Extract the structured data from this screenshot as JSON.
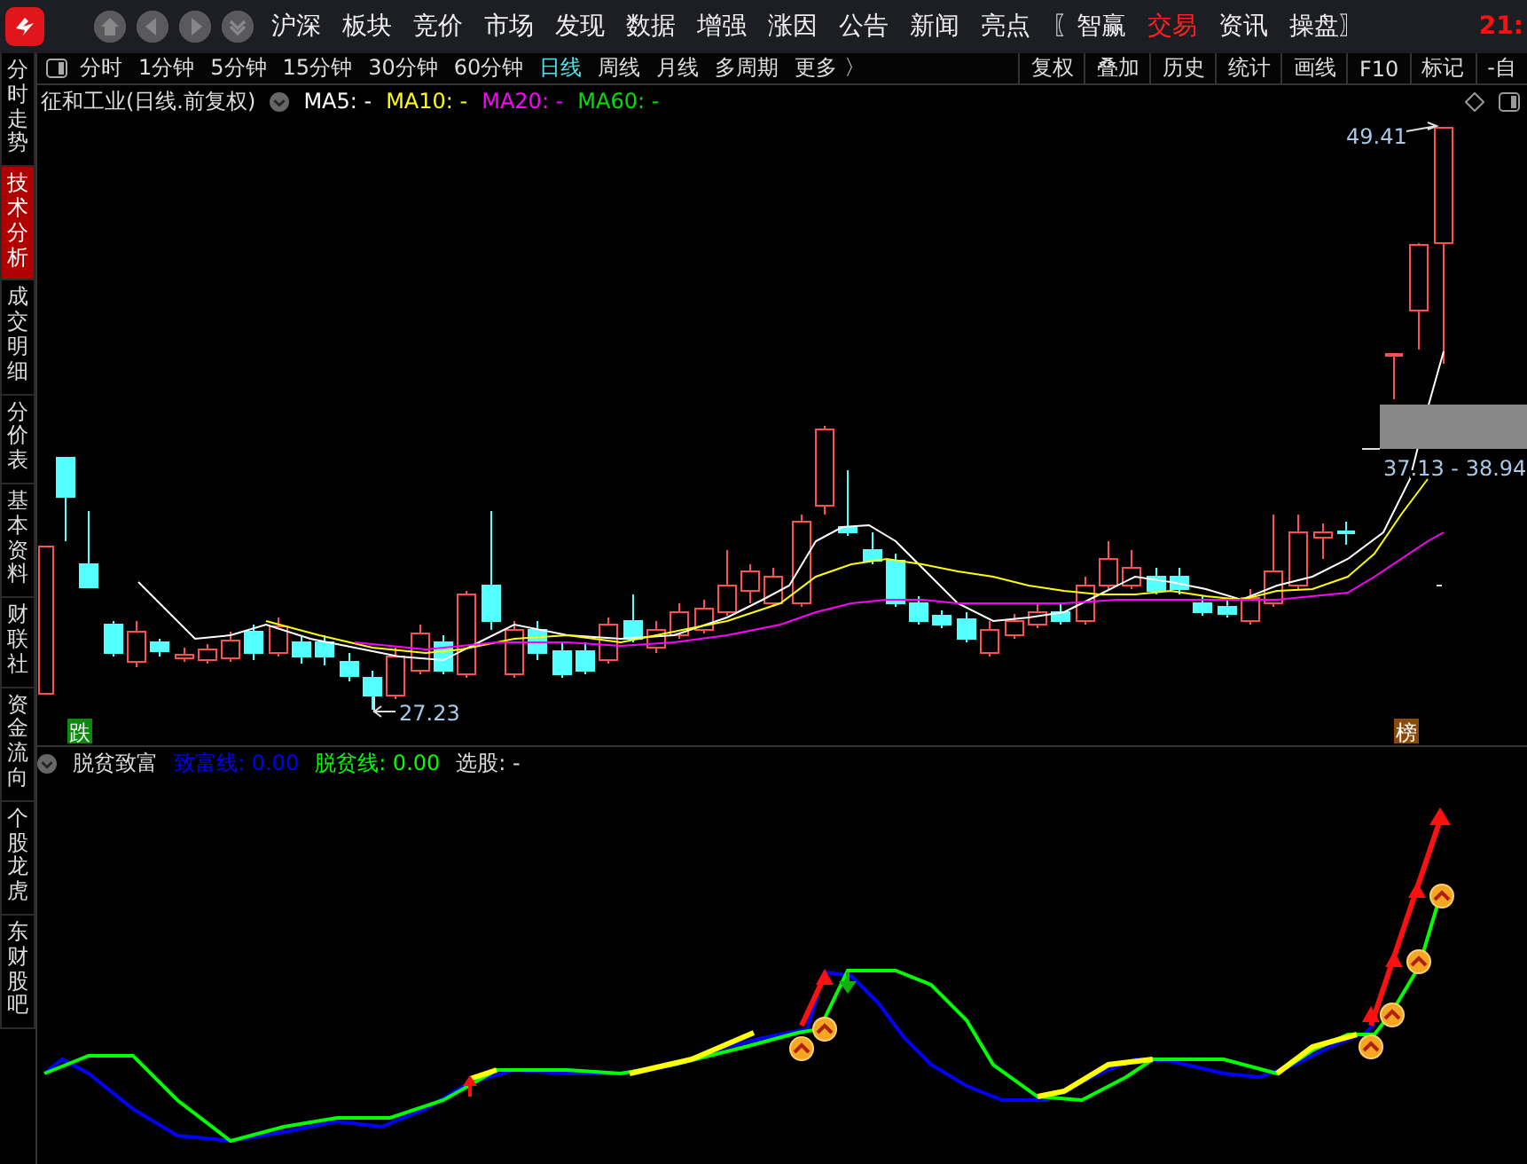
{
  "top_bar": {
    "menu": [
      {
        "label": "沪深",
        "selected": false
      },
      {
        "label": "板块",
        "selected": false
      },
      {
        "label": "竞价",
        "selected": false
      },
      {
        "label": "市场",
        "selected": false
      },
      {
        "label": "发现",
        "selected": false
      },
      {
        "label": "数据",
        "selected": false
      },
      {
        "label": "增强",
        "selected": false
      },
      {
        "label": "涨因",
        "selected": false
      },
      {
        "label": "公告",
        "selected": false
      },
      {
        "label": "新闻",
        "selected": false
      },
      {
        "label": "亮点",
        "selected": false
      },
      {
        "label": "〖智赢",
        "selected": false
      },
      {
        "label": "交易",
        "selected": true
      },
      {
        "label": "资讯",
        "selected": false
      },
      {
        "label": "操盘〗",
        "selected": false
      }
    ],
    "clock": "21:"
  },
  "period_tabs": [
    {
      "label": "分时",
      "selected": false
    },
    {
      "label": "1分钟",
      "selected": false
    },
    {
      "label": "5分钟",
      "selected": false
    },
    {
      "label": "15分钟",
      "selected": false
    },
    {
      "label": "30分钟",
      "selected": false
    },
    {
      "label": "60分钟",
      "selected": false
    },
    {
      "label": "日线",
      "selected": true
    },
    {
      "label": "周线",
      "selected": false
    },
    {
      "label": "月线",
      "selected": false
    },
    {
      "label": "多周期",
      "selected": false
    },
    {
      "label": "更多 〉",
      "selected": false
    }
  ],
  "tools": [
    "复权",
    "叠加",
    "历史",
    "统计",
    "画线",
    "F10",
    "标记",
    "-自"
  ],
  "sidebar": {
    "items": [
      {
        "label": "分时走势",
        "selected": false
      },
      {
        "label": "技术分析",
        "selected": true
      },
      {
        "label": "成交明细",
        "selected": false
      },
      {
        "label": "分价表",
        "selected": false
      },
      {
        "label": "基本资料",
        "selected": false
      },
      {
        "label": "财联社",
        "selected": false
      },
      {
        "label": "资金流向",
        "selected": false
      },
      {
        "label": "个股龙虎",
        "selected": false
      },
      {
        "label": "东财股吧",
        "selected": false
      }
    ]
  },
  "price_chart": {
    "title": "征和工业(日线.前复权)",
    "legend": [
      {
        "label": "MA5: -",
        "color": "#ffffff"
      },
      {
        "label": "MA10: -",
        "color": "#ffff00"
      },
      {
        "label": "MA20: -",
        "color": "#ff00ff"
      },
      {
        "label": "MA60: -",
        "color": "#00e000"
      }
    ],
    "high_label": "49.41",
    "low_label": "27.23",
    "range_label": "37.13 - 38.94",
    "markers": [
      {
        "label": "跌",
        "kind": "fall"
      },
      {
        "label": "榜",
        "kind": "list"
      }
    ]
  },
  "indicator": {
    "name": "脱贫致富",
    "legend": [
      {
        "label": "致富线: 0.00",
        "color": "#0000ff"
      },
      {
        "label": "脱贫线: 0.00",
        "color": "#00ff00"
      },
      {
        "label": "选股: -",
        "color": "#dddddd"
      }
    ]
  }
}
